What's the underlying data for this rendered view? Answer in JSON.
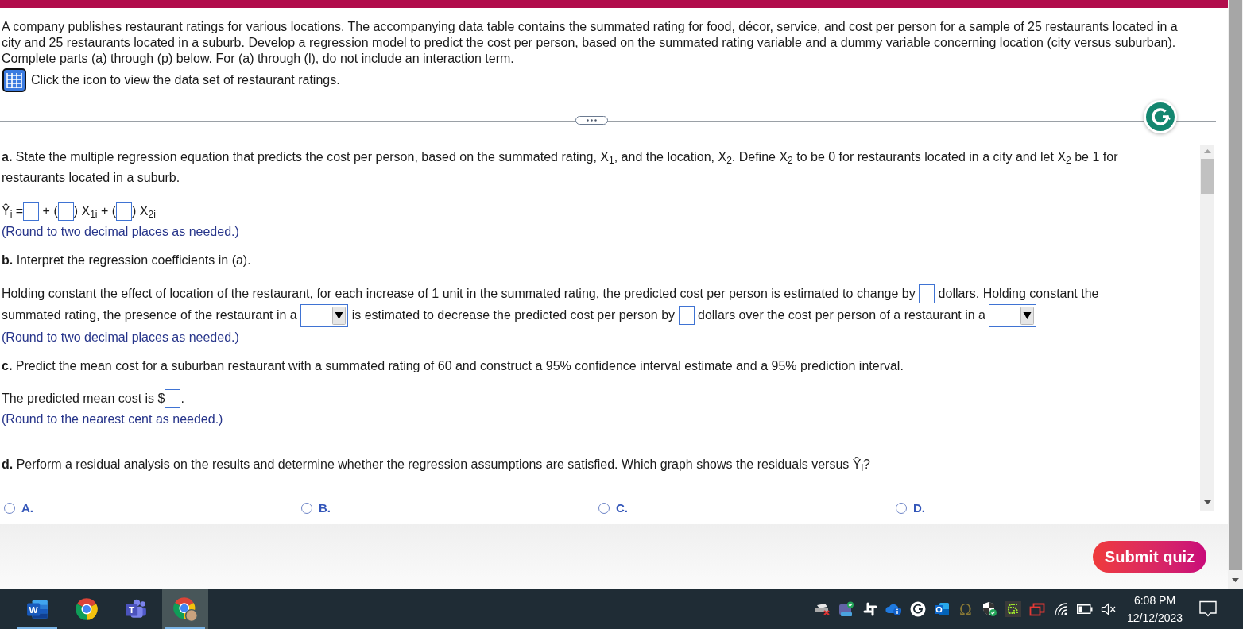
{
  "intro": {
    "text": "A company publishes restaurant ratings for various locations. The accompanying data table contains the summated rating for food, décor, service, and cost per person for a sample of 25 restaurants located in a city and 25 restaurants located in a suburb. Develop a regression model to predict the cost per person, based on the summated rating variable and a dummy variable concerning location (city versus suburban). Complete parts (a) through (p) below. For (a) through (l), do not include an interaction term.",
    "data_link": "Click the icon to view the data set of restaurant ratings."
  },
  "parts": [
    {
      "prompt": "**a.** State the multiple regression equation that predicts the cost per person, based on the summated rating, X$_{1}$, and the location, X$_{2}$. Define X$_{2}$ to be 0 for restaurants located in a city and let X$_{2}$ be 1 for restaurants located in a suburb.",
      "answer": [
        {
          "kind": "text",
          "text": "Ŷ$_{i}$ ="
        },
        {
          "kind": "input"
        },
        {
          "kind": "text",
          "text": " + ("
        },
        {
          "kind": "input"
        },
        {
          "kind": "text",
          "text": ") X$_{1i}$ + ("
        },
        {
          "kind": "input"
        },
        {
          "kind": "text",
          "text": ") X$_{2i}$"
        }
      ],
      "note": "(Round to two decimal places as needed.)"
    },
    {
      "prompt": "**b.** Interpret the regression coefficients in (a).",
      "answer": [
        {
          "kind": "text",
          "text": "Holding constant the effect of location of the restaurant, for each increase of 1 unit in the summated rating, the predicted cost per person is estimated to change by "
        },
        {
          "kind": "input"
        },
        {
          "kind": "text",
          "text": " dollars. Holding constant the"
        },
        {
          "kind": "text",
          "text": "summated rating, the presence of the restaurant in a "
        },
        {
          "kind": "select"
        },
        {
          "kind": "text",
          "text": " is estimated to decrease the predicted cost per person by "
        },
        {
          "kind": "input"
        },
        {
          "kind": "text",
          "text": " dollars over the cost per person of a restaurant in a "
        },
        {
          "kind": "select"
        }
      ],
      "note": "(Round to two decimal places as needed.)"
    },
    {
      "prompt": "**c.** Predict the mean cost for a suburban restaurant with a summated rating of 60 and construct a 95% confidence interval estimate and a 95% prediction interval.",
      "answer": [
        {
          "kind": "text",
          "text": "The predicted mean cost is $"
        },
        {
          "kind": "input"
        },
        {
          "kind": "text",
          "text": "."
        }
      ],
      "note": "(Round to the nearest cent as needed.)"
    },
    {
      "prompt": "**d.** Perform a residual analysis on the results and determine whether the regression assumptions are satisfied. Which graph shows the residuals versus Ŷ$_{i}$?",
      "options": [
        {
          "label": "A.",
          "selected": false
        },
        {
          "label": "B.",
          "selected": false
        },
        {
          "label": "C.",
          "selected": false
        },
        {
          "label": "D.",
          "selected": false
        }
      ]
    }
  ],
  "footer": {
    "submit": "Submit quiz"
  },
  "taskbar": {
    "apps": [
      {
        "kind": "document",
        "letter": "W",
        "open": true,
        "selected": false
      },
      {
        "kind": "browser",
        "open": false,
        "selected": false
      },
      {
        "kind": "chat",
        "letter": "T",
        "open": false,
        "selected": false
      },
      {
        "kind": "browser-profile",
        "open": true,
        "selected": true
      }
    ],
    "tray_symbol": "Ω",
    "time": "6:08 PM",
    "date": "12/12/2023"
  }
}
